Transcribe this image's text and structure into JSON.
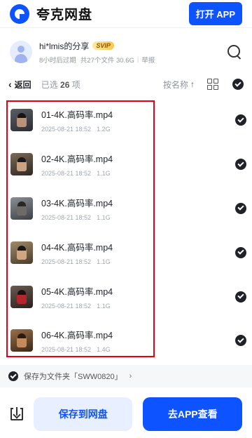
{
  "header": {
    "app_name": "夸克网盘",
    "open_app_label": "打开 APP"
  },
  "share": {
    "title": "hi*lmis的分享",
    "badge": "SVIP",
    "expiry": "8小时后过期",
    "summary": "共27个文件 30.6G",
    "report": "举报"
  },
  "toolbar": {
    "back_label": "返回",
    "selected_prefix": "已选",
    "selected_count": "26",
    "selected_suffix": "项",
    "sort_label": "按名称",
    "sort_arrow": "↑"
  },
  "files": [
    {
      "name": "01-4K.高码率.mp4",
      "date": "2025-08-21 18:52",
      "size": "1.2G"
    },
    {
      "name": "02-4K.高码率.mp4",
      "date": "2025-08-21 18:52",
      "size": "1.1G"
    },
    {
      "name": "03-4K.高码率.mp4",
      "date": "2025-08-21 18:52",
      "size": "1.1G"
    },
    {
      "name": "04-4K.高码率.mp4",
      "date": "2025-08-21 18:52",
      "size": "1.1G"
    },
    {
      "name": "05-4K.高码率.mp4",
      "date": "2025-08-21 18:52",
      "size": "1.1G"
    },
    {
      "name": "06-4K.高码率.mp4",
      "date": "2025-08-21 18:52",
      "size": "1.4G"
    }
  ],
  "save_folder": {
    "label": "保存为文件夹「SWW0820」",
    "chevron": "›"
  },
  "bottom": {
    "save_label": "保存到网盘",
    "open_label": "去APP查看"
  },
  "colors": {
    "brand": "#0d53ff",
    "highlight_frame": "#e60012"
  },
  "icons": [
    "quark-logo-icon",
    "avatar-icon",
    "search-icon",
    "back-chevron-icon",
    "grid-view-icon",
    "check-icon",
    "video-thumbnail",
    "download-icon"
  ]
}
